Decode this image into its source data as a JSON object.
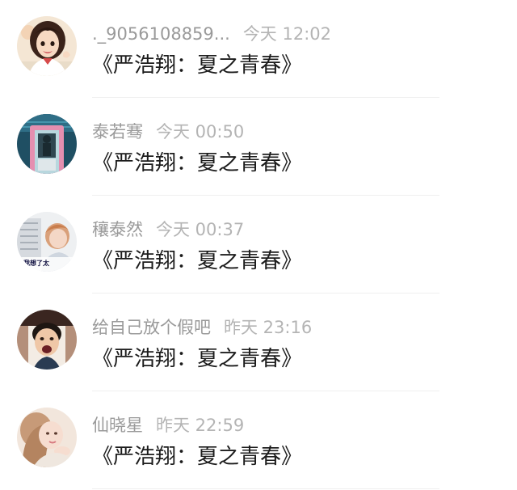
{
  "comments": [
    {
      "username": "._9056108859...",
      "time": "今天 12:02",
      "message": "《严浩翔：夏之青春》",
      "avatar_icon": "anime-girl-avatar"
    },
    {
      "username": "泰若骞",
      "time": "今天 00:50",
      "message": "《严浩翔：夏之青春》",
      "avatar_icon": "teal-doorway-avatar"
    },
    {
      "username": "穰泰然",
      "time": "今天 00:37",
      "message": "《严浩翔：夏之青春》",
      "avatar_icon": "boy-building-avatar"
    },
    {
      "username": "给自己放个假吧",
      "time": "昨天 23:16",
      "message": "《严浩翔：夏之青春》",
      "avatar_icon": "shouting-face-avatar"
    },
    {
      "username": "仙晓星",
      "time": "昨天 22:59",
      "message": "《严浩翔：夏之青春》",
      "avatar_icon": "girl-portrait-avatar"
    }
  ],
  "avatar_texts": {
    "boy_building": "我想了太"
  }
}
